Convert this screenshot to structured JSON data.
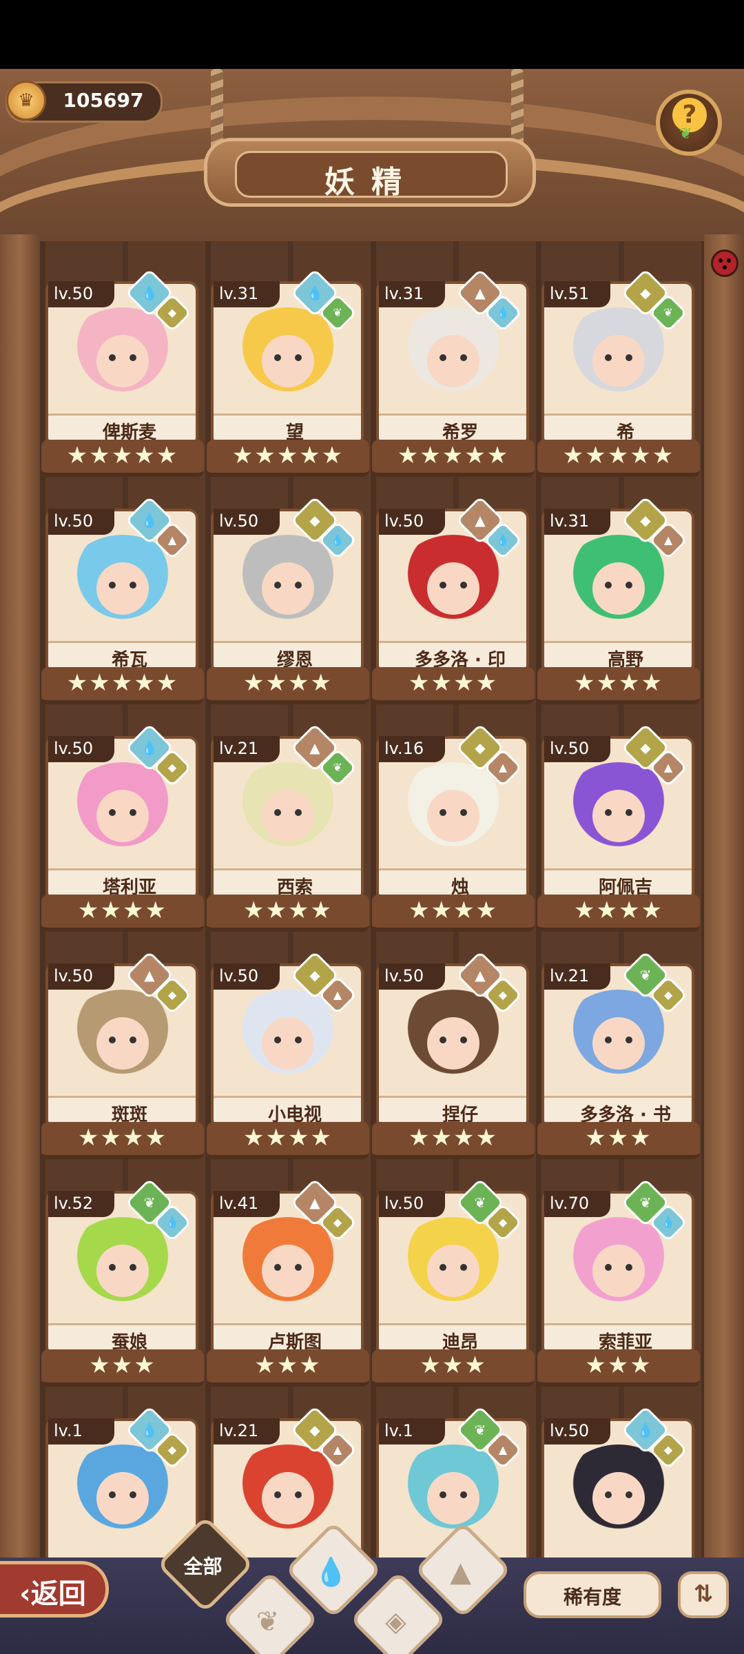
{
  "currency": {
    "value": "105697",
    "icon": "crown-coin-icon"
  },
  "title": "妖精",
  "help_icon": "question-leaf-icon",
  "cards": [
    {
      "level": "lv.50",
      "name": "俾斯麦",
      "stars": "★★★★★",
      "elements": [
        "water",
        "earth"
      ],
      "color": "#f4b4c4"
    },
    {
      "level": "lv.31",
      "name": "望",
      "stars": "★★★★★",
      "elements": [
        "water",
        "wood"
      ],
      "color": "#f6c94a"
    },
    {
      "level": "lv.31",
      "name": "希罗",
      "stars": "★★★★★",
      "elements": [
        "rock",
        "water"
      ],
      "color": "#ece7e0"
    },
    {
      "level": "lv.51",
      "name": "希",
      "stars": "★★★★★",
      "elements": [
        "earth",
        "wood"
      ],
      "color": "#d7d7de"
    },
    {
      "level": "lv.50",
      "name": "希瓦",
      "stars": "★★★★★",
      "elements": [
        "water",
        "rock"
      ],
      "color": "#79c9ea"
    },
    {
      "level": "lv.50",
      "name": "缪恩",
      "stars": "★★★★",
      "elements": [
        "earth",
        "water"
      ],
      "color": "#bdbdbd"
    },
    {
      "level": "lv.50",
      "name": "多多洛 · 印",
      "stars": "★★★★",
      "elements": [
        "rock",
        "water"
      ],
      "color": "#c92d30"
    },
    {
      "level": "lv.31",
      "name": "高野",
      "stars": "★★★★",
      "elements": [
        "earth",
        "rock"
      ],
      "color": "#3fbf74"
    },
    {
      "level": "lv.50",
      "name": "塔利亚",
      "stars": "★★★★",
      "elements": [
        "water",
        "earth"
      ],
      "color": "#f29ac8"
    },
    {
      "level": "lv.21",
      "name": "西索",
      "stars": "★★★★",
      "elements": [
        "rock",
        "wood"
      ],
      "color": "#e8e3b2"
    },
    {
      "level": "lv.16",
      "name": "烛",
      "stars": "★★★★",
      "elements": [
        "earth",
        "rock"
      ],
      "color": "#f3f0e6"
    },
    {
      "level": "lv.50",
      "name": "阿佩吉",
      "stars": "★★★★",
      "elements": [
        "earth",
        "rock"
      ],
      "color": "#8a55d4"
    },
    {
      "level": "lv.50",
      "name": "斑斑",
      "stars": "★★★★",
      "elements": [
        "rock",
        "earth"
      ],
      "color": "#b59a72"
    },
    {
      "level": "lv.50",
      "name": "小电视",
      "stars": "★★★★",
      "elements": [
        "earth",
        "rock"
      ],
      "color": "#dfe5f0"
    },
    {
      "level": "lv.50",
      "name": "捏仔",
      "stars": "★★★★",
      "elements": [
        "rock",
        "earth"
      ],
      "color": "#6c4a33"
    },
    {
      "level": "lv.21",
      "name": "多多洛 · 书",
      "stars": "★★★",
      "elements": [
        "wood",
        "earth"
      ],
      "color": "#7ca7e0"
    },
    {
      "level": "lv.52",
      "name": "蚕娘",
      "stars": "★★★",
      "elements": [
        "wood",
        "water"
      ],
      "color": "#a6d84c"
    },
    {
      "level": "lv.41",
      "name": "卢斯图",
      "stars": "★★★",
      "elements": [
        "rock",
        "earth"
      ],
      "color": "#ef7a3a"
    },
    {
      "level": "lv.50",
      "name": "迪昂",
      "stars": "★★★",
      "elements": [
        "wood",
        "earth"
      ],
      "color": "#f4d24a"
    },
    {
      "level": "lv.70",
      "name": "索菲亚",
      "stars": "★★★",
      "elements": [
        "wood",
        "water"
      ],
      "color": "#f2a1cf"
    },
    {
      "level": "lv.1",
      "name": "",
      "stars": "",
      "elements": [
        "water",
        "earth"
      ],
      "color": "#5aa7e0"
    },
    {
      "level": "lv.21",
      "name": "",
      "stars": "",
      "elements": [
        "earth",
        "rock"
      ],
      "color": "#d9432f"
    },
    {
      "level": "lv.1",
      "name": "",
      "stars": "",
      "elements": [
        "wood",
        "rock"
      ],
      "color": "#6ec8d6"
    },
    {
      "level": "lv.50",
      "name": "",
      "stars": "",
      "elements": [
        "water",
        "earth"
      ],
      "color": "#2e2a35"
    }
  ],
  "bottom": {
    "back_label": "返回",
    "filter_all": "全部",
    "sort_label": "稀有度",
    "order_icon": "sort-order-icon"
  }
}
